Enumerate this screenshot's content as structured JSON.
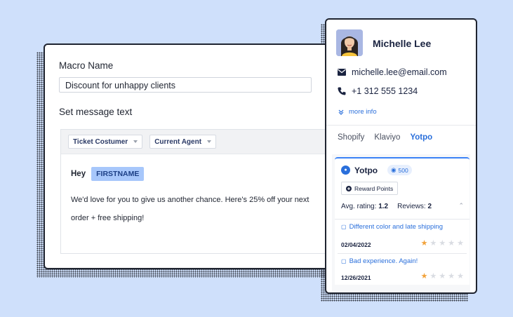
{
  "macro": {
    "name_label": "Macro Name",
    "name_value": "Discount for unhappy clients",
    "message_label": "Set message text",
    "toolbar": [
      "Ticket Costumer",
      "Current Agent"
    ],
    "greeting": "Hey",
    "placeholder_tag": "FIRSTNAME",
    "message": "We'd love for you to give us another chance. Here's 25% off your next order + free shipping!"
  },
  "profile": {
    "name": "Michelle Lee",
    "email": "michelle.lee@email.com",
    "phone": "+1 312 555 1234",
    "more_info": "more info",
    "tabs": [
      "Shopify",
      "Klaviyo",
      "Yotpo"
    ],
    "active_tab": "Yotpo"
  },
  "yotpo": {
    "title": "Yotpo",
    "points": "500",
    "reward_button": "Reward Points",
    "avg_label": "Avg. rating:",
    "avg_value": "1.2",
    "reviews_label": "Reviews:",
    "reviews_value": "2",
    "reviews": [
      {
        "title": "Different color and late shipping",
        "date": "02/04/2022",
        "rating": 1
      },
      {
        "title": "Bad experience. Again!",
        "date": "12/26/2021",
        "rating": 1
      }
    ]
  },
  "colors": {
    "background": "#cfe0fb",
    "accent": "#2a6fdb",
    "tag": "#a7c7fb",
    "star": "#f2a23a"
  }
}
